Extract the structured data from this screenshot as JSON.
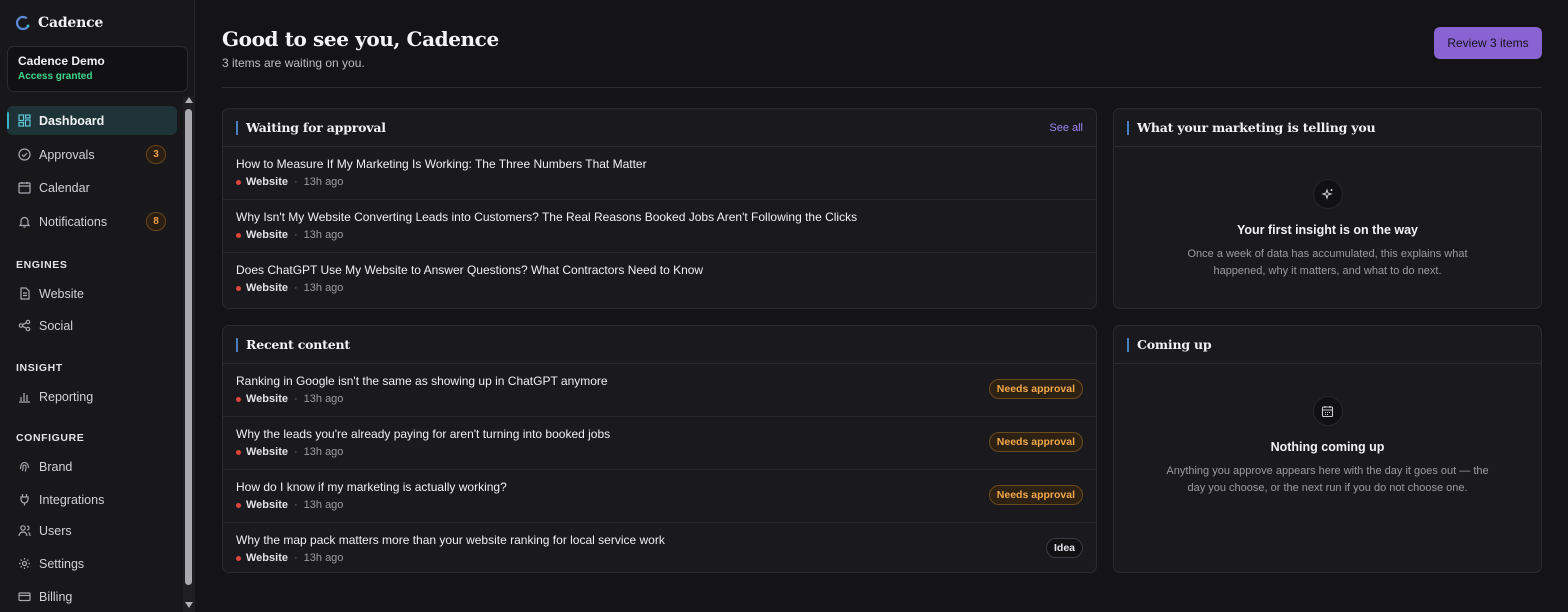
{
  "brand": {
    "name": "Cadence"
  },
  "workspace": {
    "name": "Cadence Demo",
    "status": "Access granted"
  },
  "nav": {
    "dashboard": "Dashboard",
    "approvals": "Approvals",
    "approvals_count": "3",
    "calendar": "Calendar",
    "notifications": "Notifications",
    "notifications_count": "8",
    "engines_heading": "ENGINES",
    "website": "Website",
    "social": "Social",
    "insight_heading": "INSIGHT",
    "reporting": "Reporting",
    "configure_heading": "CONFIGURE",
    "brand": "Brand",
    "integrations": "Integrations",
    "users": "Users",
    "settings": "Settings",
    "billing": "Billing"
  },
  "header": {
    "greeting": "Good to see you, Cadence",
    "subtext": "3 items are waiting on you.",
    "review_button": "Review 3 items"
  },
  "approval": {
    "title": "Waiting for approval",
    "see_all": "See all",
    "items": [
      {
        "title": "How to Measure If My Marketing Is Working: The Three Numbers That Matter",
        "channel": "Website",
        "sep": "·",
        "time": "13h ago"
      },
      {
        "title": "Why Isn't My Website Converting Leads into Customers? The Real Reasons Booked Jobs Aren't Following the Clicks",
        "channel": "Website",
        "sep": "·",
        "time": "13h ago"
      },
      {
        "title": "Does ChatGPT Use My Website to Answer Questions? What Contractors Need to Know",
        "channel": "Website",
        "sep": "·",
        "time": "13h ago"
      }
    ]
  },
  "insight": {
    "title": "What your marketing is telling you",
    "icon": "sparkle-icon",
    "empty_title": "Your first insight is on the way",
    "empty_body": "Once a week of data has accumulated, this explains what happened, why it matters, and what to do next."
  },
  "recent": {
    "title": "Recent content",
    "items": [
      {
        "title": "Ranking in Google isn't the same as showing up in ChatGPT anymore",
        "channel": "Website",
        "sep": "·",
        "time": "13h ago",
        "status": "Needs approval"
      },
      {
        "title": "Why the leads you're already paying for aren't turning into booked jobs",
        "channel": "Website",
        "sep": "·",
        "time": "13h ago",
        "status": "Needs approval"
      },
      {
        "title": "How do I know if my marketing is actually working?",
        "channel": "Website",
        "sep": "·",
        "time": "13h ago",
        "status": "Needs approval"
      },
      {
        "title": "Why the map pack matters more than your website ranking for local service work",
        "channel": "Website",
        "sep": "·",
        "time": "13h ago",
        "status": "Idea"
      }
    ]
  },
  "coming_up": {
    "title": "Coming up",
    "icon": "calendar-icon",
    "empty_title": "Nothing coming up",
    "empty_body": "Anything you approve appears here with the day it goes out — the day you choose, or the next run if you do not choose one."
  },
  "colors": {
    "accent": "#8a63d2",
    "active_nav": "#1d3338",
    "success": "#3dd68c",
    "warning": "#f0a84a",
    "dot": "#e0453a"
  }
}
